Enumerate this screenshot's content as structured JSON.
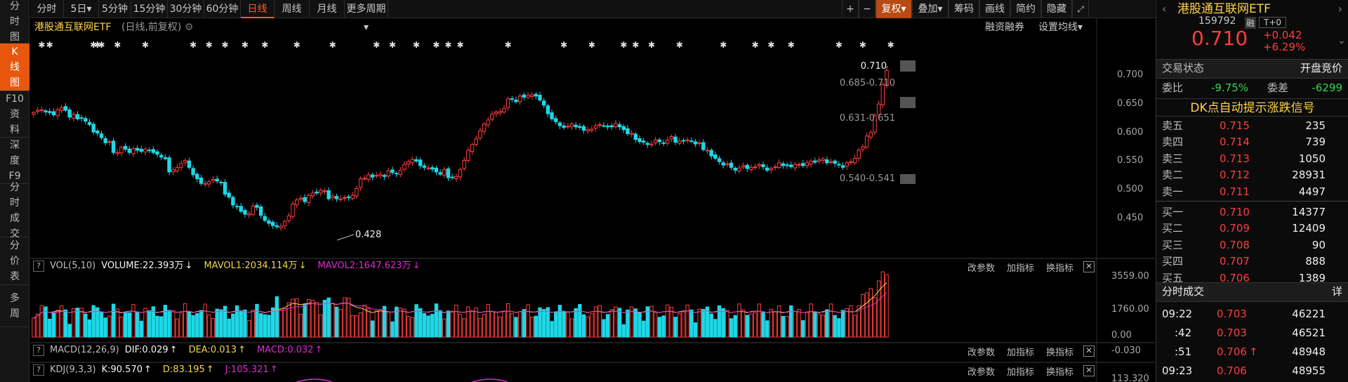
{
  "leftbar": [
    {
      "label": "分\n时\n图"
    },
    {
      "label": "K\n线\n图"
    },
    {
      "label": "F10\n资\n料"
    },
    {
      "label": "深\n度\nF9"
    },
    {
      "label": "分\n时\n成\n交"
    },
    {
      "label": "分\n价\n表"
    },
    {
      "label": "多\n周"
    }
  ],
  "toolbar": {
    "periods": [
      "分时",
      "5日▾",
      "5分钟",
      "15分钟",
      "30分钟",
      "60分钟",
      "日线",
      "周线",
      "月线",
      "更多周期▾"
    ],
    "active_period": "日线",
    "right_buttons": [
      "+",
      "−",
      "复权▾",
      "叠加▾",
      "筹码",
      "画线",
      "简约",
      "隐藏"
    ]
  },
  "chart_header": {
    "name": "港股通互联网ETF",
    "subtitle": "(日线,前复权)",
    "links": [
      "融资融券",
      "设置均线▾"
    ]
  },
  "chart_data": [
    {
      "type": "candlestick",
      "title": "港股通互联网ETF",
      "y_ticks": [
        "0.700",
        "0.650",
        "0.600",
        "0.550",
        "0.500",
        "0.450"
      ],
      "ylim": [
        0.415,
        0.725
      ],
      "annotations": {
        "latest": "0.710",
        "range_high": "0.685-0.710",
        "range_mid": "0.631-0.651",
        "range_low": "0.540-0.541",
        "low_mark": "0.428"
      },
      "close": [
        0.636,
        0.64,
        0.641,
        0.637,
        0.636,
        0.632,
        0.641,
        0.645,
        0.64,
        0.628,
        0.633,
        0.625,
        0.626,
        0.621,
        0.615,
        0.602,
        0.6,
        0.592,
        0.583,
        0.585,
        0.566,
        0.566,
        0.575,
        0.572,
        0.566,
        0.573,
        0.57,
        0.568,
        0.572,
        0.57,
        0.566,
        0.563,
        0.558,
        0.555,
        0.532,
        0.536,
        0.54,
        0.547,
        0.552,
        0.54,
        0.527,
        0.52,
        0.512,
        0.512,
        0.515,
        0.519,
        0.516,
        0.514,
        0.493,
        0.488,
        0.474,
        0.471,
        0.463,
        0.458,
        0.459,
        0.472,
        0.47,
        0.456,
        0.447,
        0.442,
        0.438,
        0.436,
        0.437,
        0.445,
        0.455,
        0.476,
        0.483,
        0.486,
        0.48,
        0.491,
        0.495,
        0.495,
        0.5,
        0.499,
        0.485,
        0.49,
        0.485,
        0.485,
        0.487,
        0.487,
        0.491,
        0.503,
        0.52,
        0.521,
        0.527,
        0.523,
        0.526,
        0.528,
        0.524,
        0.534,
        0.531,
        0.529,
        0.535,
        0.545,
        0.55,
        0.554,
        0.551,
        0.543,
        0.54,
        0.539,
        0.537,
        0.532,
        0.528,
        0.536,
        0.522,
        0.522,
        0.524,
        0.536,
        0.552,
        0.57,
        0.58,
        0.59,
        0.604,
        0.616,
        0.623,
        0.633,
        0.637,
        0.638,
        0.643,
        0.66,
        0.66,
        0.655,
        0.665,
        0.663,
        0.666,
        0.667,
        0.665,
        0.658,
        0.649,
        0.634,
        0.625,
        0.62,
        0.613,
        0.61,
        0.612,
        0.616,
        0.611,
        0.61,
        0.605,
        0.606,
        0.607,
        0.613,
        0.615,
        0.613,
        0.611,
        0.611,
        0.617,
        0.611,
        0.606,
        0.599,
        0.6,
        0.589,
        0.585,
        0.584,
        0.58,
        0.581,
        0.588,
        0.585,
        0.582,
        0.588,
        0.594,
        0.584,
        0.586,
        0.586,
        0.588,
        0.586,
        0.581,
        0.583,
        0.571,
        0.57,
        0.56,
        0.556,
        0.55,
        0.544,
        0.546,
        0.54,
        0.535,
        0.539,
        0.543,
        0.538,
        0.54,
        0.541,
        0.545,
        0.541,
        0.535,
        0.538,
        0.541,
        0.548,
        0.543,
        0.543,
        0.541,
        0.545,
        0.545,
        0.543,
        0.548,
        0.551,
        0.549,
        0.553,
        0.555,
        0.548,
        0.55,
        0.547,
        0.544,
        0.54,
        0.548,
        0.55,
        0.556,
        0.57,
        0.576,
        0.595,
        0.601,
        0.631,
        0.651,
        0.685,
        0.71
      ]
    },
    {
      "type": "bar",
      "title": "VOL(5,10)",
      "y_ticks": [
        "3559.00",
        "1760.00",
        "0.00"
      ],
      "ylim": [
        0,
        3700
      ],
      "series": [
        {
          "name": "VOLUME",
          "value_label": "VOLUME:22.393万",
          "arrow": "↓",
          "color": "#f5f5f5"
        },
        {
          "name": "MAVOL1",
          "value_label": "MAVOL1:2034.114万",
          "arrow": "↓",
          "color": "#f0d64a"
        },
        {
          "name": "MAVOL2",
          "value_label": "MAVOL2:1647.623万",
          "arrow": "↓",
          "color": "#e02ad4"
        }
      ]
    },
    {
      "type": "line",
      "title": "MACD(12,26,9)",
      "y_ticks": [
        "-0.030"
      ],
      "series": [
        {
          "name": "DIF",
          "value_label": "DIF:0.029",
          "arrow": "↑",
          "color": "#f5f5f5"
        },
        {
          "name": "DEA",
          "value_label": "DEA:0.013",
          "arrow": "↑",
          "color": "#f0d64a"
        },
        {
          "name": "MACD",
          "value_label": "MACD:0.032",
          "arrow": "↑",
          "color": "#e02ad4"
        }
      ]
    },
    {
      "type": "line",
      "title": "KDJ(9,3,3)",
      "y_ticks": [
        "113.320"
      ],
      "series": [
        {
          "name": "K",
          "value_label": "K:90.570",
          "arrow": "↑",
          "color": "#f5f5f5"
        },
        {
          "name": "D",
          "value_label": "D:83.195",
          "arrow": "↑",
          "color": "#f0d64a"
        },
        {
          "name": "J",
          "value_label": "J:105.321",
          "arrow": "↑",
          "color": "#e02ad4"
        }
      ]
    }
  ],
  "indicator_controls": [
    "改参数",
    "加指标",
    "换指标"
  ],
  "close_glyph": "✕",
  "help_glyph": "?",
  "right_panel": {
    "name": "港股通互联网ETF",
    "code": "159792",
    "tag_margin": "融",
    "tag_t0": "T+0",
    "price": "0.710",
    "change": "+0.042",
    "change_pct": "+6.29%",
    "status_label": "交易状态",
    "status_value": "开盘竞价",
    "ratio_label": "委比",
    "ratio_value": "-9.75%",
    "diff_label": "委差",
    "diff_value": "-6299",
    "signal_banner": "DK点自动提示涨跌信号",
    "asks": [
      {
        "label": "卖五",
        "price": "0.715",
        "vol": "235"
      },
      {
        "label": "卖四",
        "price": "0.714",
        "vol": "739"
      },
      {
        "label": "卖三",
        "price": "0.713",
        "vol": "1050"
      },
      {
        "label": "卖二",
        "price": "0.712",
        "vol": "28931"
      },
      {
        "label": "卖一",
        "price": "0.711",
        "vol": "4497"
      }
    ],
    "bids": [
      {
        "label": "买一",
        "price": "0.710",
        "vol": "14377"
      },
      {
        "label": "买二",
        "price": "0.709",
        "vol": "12409"
      },
      {
        "label": "买三",
        "price": "0.708",
        "vol": "90"
      },
      {
        "label": "买四",
        "price": "0.707",
        "vol": "888"
      },
      {
        "label": "买五",
        "price": "0.706",
        "vol": "1389"
      }
    ],
    "trades_title": "分时成交",
    "trades_detail": "详",
    "trades": [
      {
        "time": "09:22",
        "price": "0.703",
        "vol": "46221",
        "arrow": ""
      },
      {
        "time": ":42",
        "price": "0.703",
        "vol": "46521",
        "arrow": ""
      },
      {
        "time": ":51",
        "price": "0.706",
        "vol": "48948",
        "arrow": "↑"
      },
      {
        "time": "09:23",
        "price": "0.706",
        "vol": "48955",
        "arrow": ""
      }
    ]
  },
  "colors": {
    "up": "#ff3d3d",
    "down": "#1fd7e6",
    "accent": "#e8570d",
    "title": "#ffd34a"
  }
}
